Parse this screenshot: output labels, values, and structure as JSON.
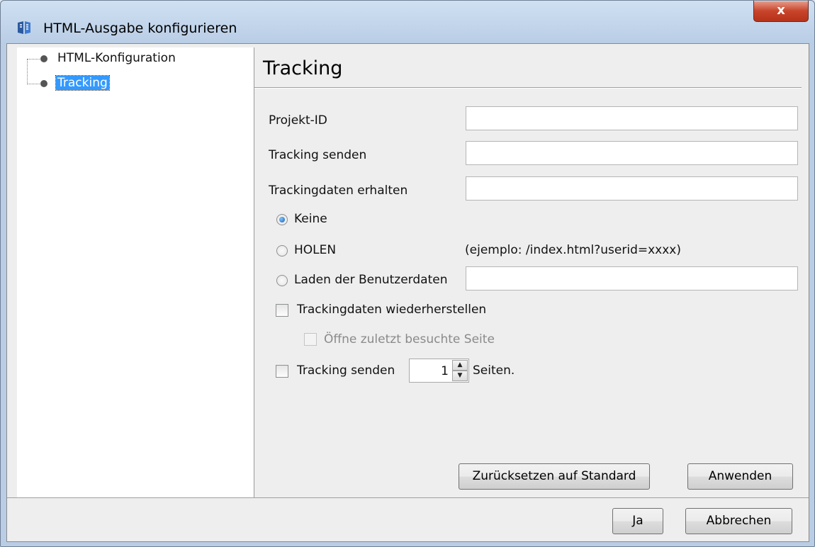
{
  "window": {
    "title": "HTML-Ausgabe konfigurieren",
    "close_label": "x"
  },
  "tree": {
    "items": [
      {
        "label": "HTML-Konfiguration",
        "selected": false
      },
      {
        "label": "Tracking",
        "selected": true
      }
    ]
  },
  "panel": {
    "title": "Tracking",
    "project_id_label": "Projekt-ID",
    "project_id_value": "",
    "send_tracking_label": "Tracking senden",
    "send_tracking_value": "",
    "receive_label": "Trackingdaten erhalten",
    "receive_value": "",
    "radio_none": "Keine",
    "radio_get": "HOLEN",
    "example_text": "(ejemplo: /index.html?userid=xxxx)",
    "radio_load": "Laden der Benutzerdaten",
    "load_value": "",
    "restore_label": "Trackingdaten wiederherstellen",
    "restore_checked": false,
    "open_last_label": "Öffne zuletzt besuchte Seite",
    "send_pages_label": "Tracking senden",
    "send_pages_value": "1",
    "pages_suffix": "Seiten.",
    "reset_button": "Zurücksetzen auf Standard",
    "apply_button": "Anwenden"
  },
  "footer": {
    "ok_button": "Ja",
    "cancel_button": "Abbrechen"
  }
}
